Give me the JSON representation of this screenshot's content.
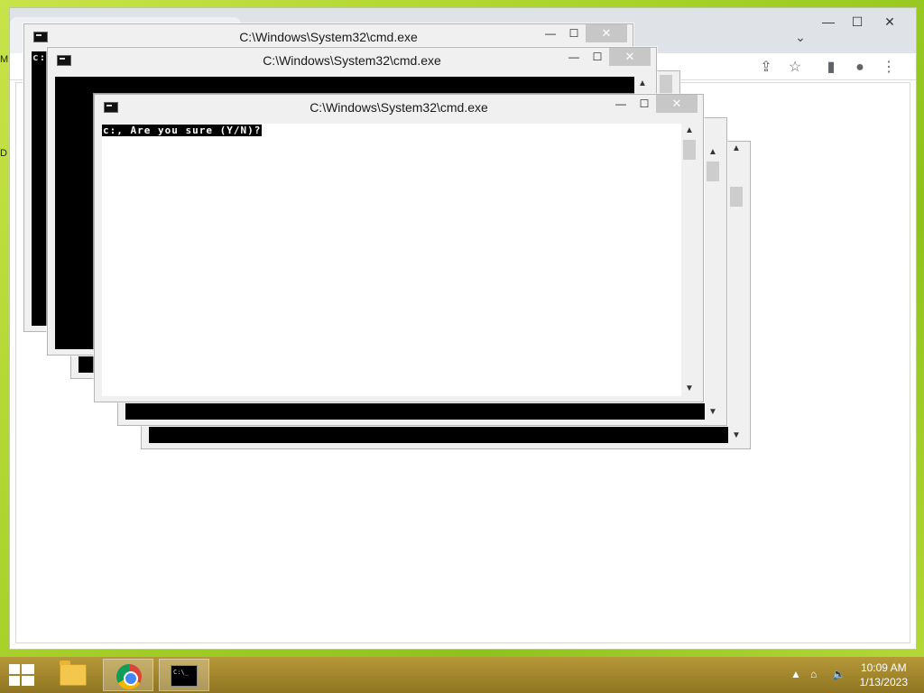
{
  "desktop": {
    "edge_labels": [
      "M",
      "D"
    ]
  },
  "chrome": {
    "window_controls": {
      "minimize": "—",
      "maximize": "☐",
      "close": "✕"
    },
    "toolbar_icons": [
      "share-icon",
      "star-icon",
      "side-panel-icon",
      "profile-icon",
      "menu-icon"
    ]
  },
  "cmd_windows": [
    {
      "title": "C:\\Windows\\System32\\cmd.exe"
    },
    {
      "title": "C:\\Windows\\System32\\cmd.exe"
    },
    {
      "title": "C:\\Windows\\System32\\cmd.exe"
    }
  ],
  "console": {
    "prompt": "c:, Are you sure (Y/N)?",
    "prompt_back": "c:"
  },
  "taskbar": {
    "items": [
      "start-button",
      "file-explorer",
      "google-chrome",
      "command-prompt"
    ],
    "clock": {
      "time": "10:09 AM",
      "date": "1/13/2023"
    }
  }
}
